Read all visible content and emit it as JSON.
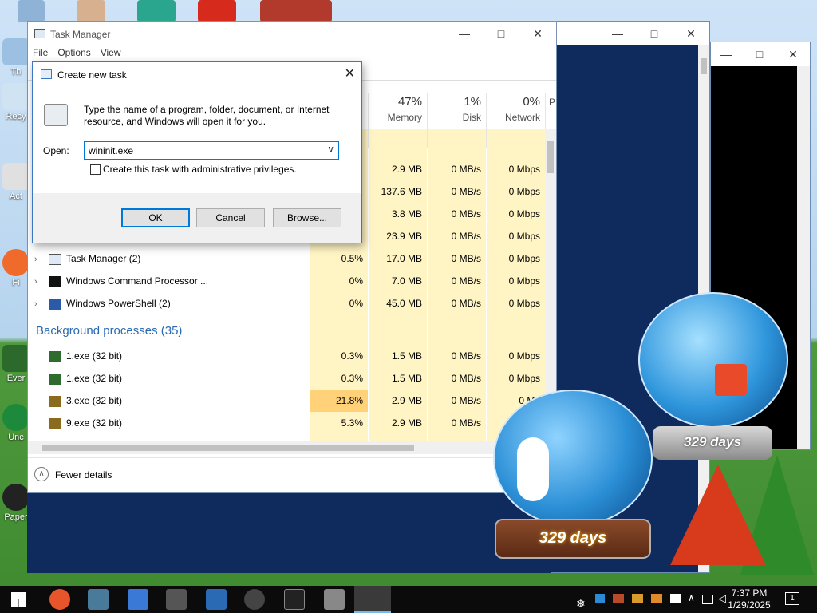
{
  "desktop": {
    "icons": [
      {
        "label": "Th"
      },
      {
        "label": "Recy"
      },
      {
        "label": "Act"
      },
      {
        "label": "Fi"
      },
      {
        "label": "Ever"
      },
      {
        "label": "Unc"
      },
      {
        "label": "Paper"
      }
    ]
  },
  "snow_globe_small": {
    "label": "329 days"
  },
  "snow_globe_large": {
    "label": "329 days"
  },
  "task_manager": {
    "title": "Task Manager",
    "menu": [
      "File",
      "Options",
      "View"
    ],
    "columns": [
      {
        "pct": "47%",
        "label": "Memory"
      },
      {
        "pct": "1%",
        "label": "Disk"
      },
      {
        "pct": "0%",
        "label": "Network"
      },
      {
        "pct": "",
        "label": "P"
      }
    ],
    "hidden_rows": [
      {
        "mem": "2.9 MB",
        "disk": "0 MB/s",
        "net": "0 Mbps"
      },
      {
        "mem": "137.6 MB",
        "disk": "0 MB/s",
        "net": "0 Mbps"
      },
      {
        "mem": "3.8 MB",
        "disk": "0 MB/s",
        "net": "0 Mbps"
      },
      {
        "mem": "23.9 MB",
        "disk": "0 MB/s",
        "net": "0 Mbps"
      }
    ],
    "apps": [
      {
        "name": "Task Manager (2)",
        "cpu": "0.5%",
        "mem": "17.0 MB",
        "disk": "0 MB/s",
        "net": "0 Mbps"
      },
      {
        "name": "Windows Command Processor ...",
        "cpu": "0%",
        "mem": "7.0 MB",
        "disk": "0 MB/s",
        "net": "0 Mbps"
      },
      {
        "name": "Windows PowerShell (2)",
        "cpu": "0%",
        "mem": "45.0 MB",
        "disk": "0 MB/s",
        "net": "0 Mbps"
      }
    ],
    "background_header": "Background processes (35)",
    "background": [
      {
        "name": "1.exe (32 bit)",
        "cpu": "0.3%",
        "mem": "1.5 MB",
        "disk": "0 MB/s",
        "net": "0 Mbps"
      },
      {
        "name": "1.exe (32 bit)",
        "cpu": "0.3%",
        "mem": "1.5 MB",
        "disk": "0 MB/s",
        "net": "0 Mbps"
      },
      {
        "name": "3.exe (32 bit)",
        "cpu": "21.8%",
        "mem": "2.9 MB",
        "disk": "0 MB/s",
        "net": "0 Mb"
      },
      {
        "name": "9.exe (32 bit)",
        "cpu": "5.3%",
        "mem": "2.9 MB",
        "disk": "0 MB/s",
        "net": "0 Mb"
      }
    ],
    "fewer_details": "Fewer details"
  },
  "dialog": {
    "title": "Create new task",
    "prompt": "Type the name of a program, folder, document, or Internet resource, and Windows will open it for you.",
    "open_label": "Open:",
    "open_value": "wininit.exe",
    "admin_label": "Create this task with administrative privileges.",
    "ok": "OK",
    "cancel": "Cancel",
    "browse": "Browse..."
  },
  "taskbar": {
    "time": "7:37 PM",
    "date": "1/29/2025",
    "notification_count": "1"
  }
}
